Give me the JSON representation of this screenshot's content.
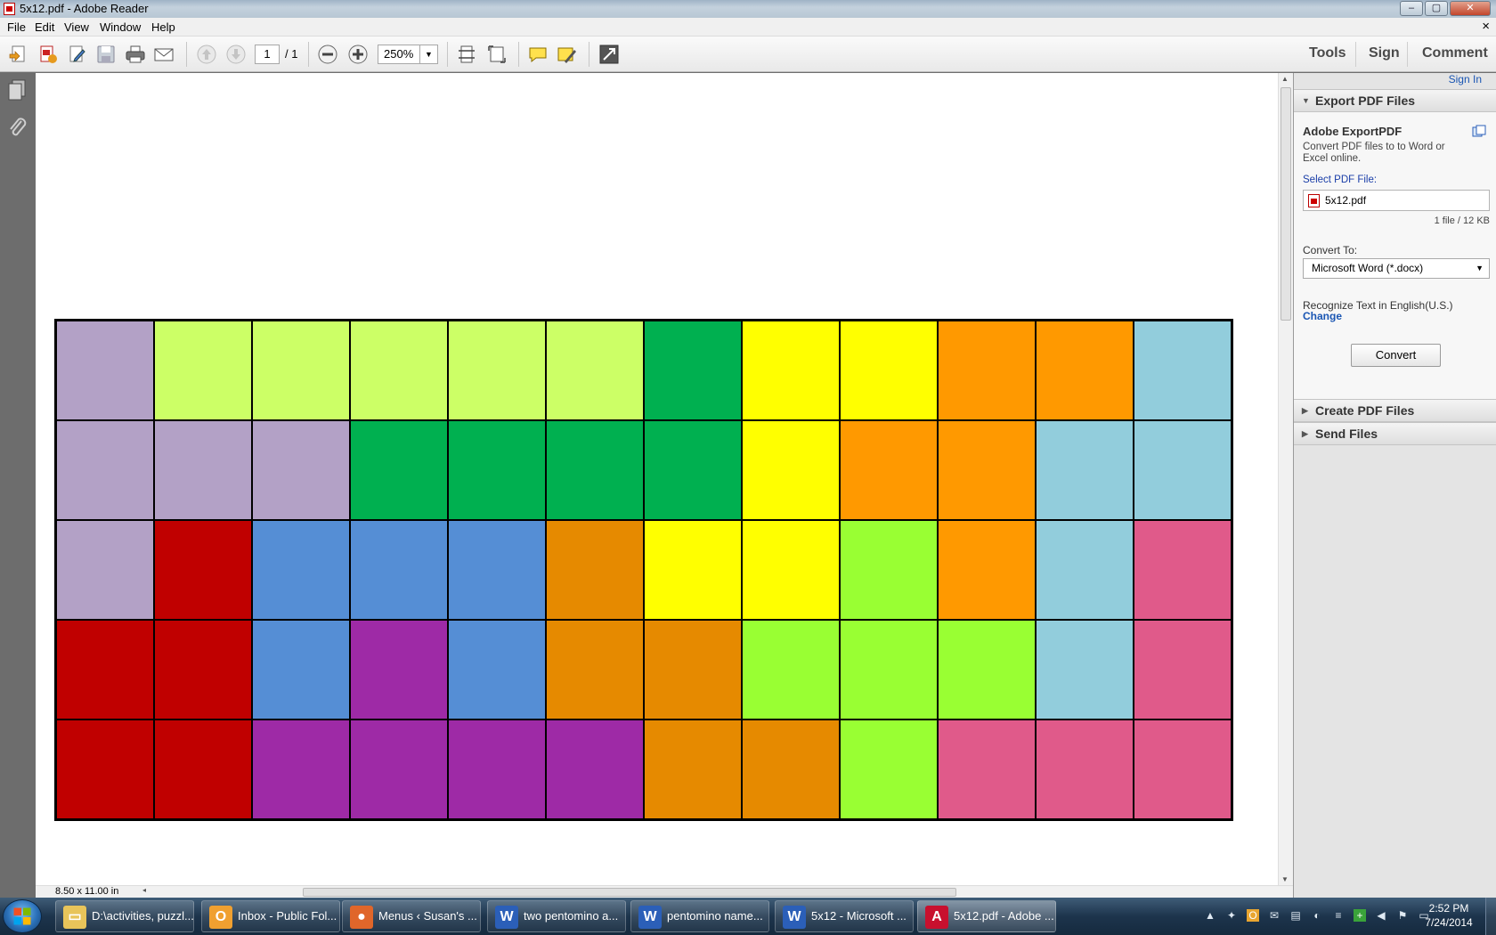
{
  "window": {
    "title": "5x12.pdf - Adobe Reader",
    "buttons": [
      "–",
      "▢",
      "✕"
    ]
  },
  "menu": {
    "items": [
      "File",
      "Edit",
      "View",
      "Window",
      "Help"
    ],
    "doc_close": "×"
  },
  "toolbar": {
    "page_current": "1",
    "page_total": "/ 1",
    "zoom": "250%",
    "right_links": [
      "Tools",
      "Sign",
      "Comment"
    ]
  },
  "document": {
    "page_size": "8.50 x 11.00 in",
    "grid_rows": [
      [
        "#b3a1c6",
        "#ccff66",
        "#ccff66",
        "#ccff66",
        "#ccff66",
        "#ccff66",
        "#00b050",
        "#ffff00",
        "#ffff00",
        "#ff9900",
        "#ff9900",
        "#92cddc"
      ],
      [
        "#b3a1c6",
        "#b3a1c6",
        "#b3a1c6",
        "#00b050",
        "#00b050",
        "#00b050",
        "#00b050",
        "#ffff00",
        "#ff9900",
        "#ff9900",
        "#92cddc",
        "#92cddc"
      ],
      [
        "#b3a1c6",
        "#c00000",
        "#558ed5",
        "#558ed5",
        "#558ed5",
        "#e68a00",
        "#ffff00",
        "#ffff00",
        "#99ff33",
        "#ff9900",
        "#92cddc",
        "#e05a8a"
      ],
      [
        "#c00000",
        "#c00000",
        "#558ed5",
        "#9e2aa6",
        "#558ed5",
        "#e68a00",
        "#e68a00",
        "#99ff33",
        "#99ff33",
        "#99ff33",
        "#92cddc",
        "#e05a8a"
      ],
      [
        "#c00000",
        "#c00000",
        "#9e2aa6",
        "#9e2aa6",
        "#9e2aa6",
        "#9e2aa6",
        "#e68a00",
        "#e68a00",
        "#99ff33",
        "#e05a8a",
        "#e05a8a",
        "#e05a8a"
      ]
    ]
  },
  "right_pane": {
    "sign_in": "Sign In",
    "export_header": "Export PDF Files",
    "export_title": "Adobe ExportPDF",
    "export_desc": "Convert PDF files to to Word or Excel online.",
    "select_label": "Select PDF File:",
    "file_name": "5x12.pdf",
    "file_info": "1 file / 12 KB",
    "convert_to_label": "Convert To:",
    "convert_to_value": "Microsoft Word (*.docx)",
    "recognize": "Recognize Text in English(U.S.)",
    "change": "Change",
    "convert_button": "Convert",
    "create_header": "Create PDF Files",
    "send_header": "Send Files"
  },
  "taskbar": {
    "tasks": [
      {
        "label": "D:\\activities, puzzl...",
        "icon": "folder-icon",
        "icon_bg": "#e8c45a",
        "glyph": "▭"
      },
      {
        "label": "Inbox - Public Fol...",
        "icon": "outlook-icon",
        "icon_bg": "#f0a030",
        "glyph": "O"
      },
      {
        "label": "Menus ‹ Susan's ...",
        "icon": "firefox-icon",
        "icon_bg": "#e0662a",
        "glyph": "●"
      },
      {
        "label": "two pentomino a...",
        "icon": "word-icon",
        "icon_bg": "#2b5fb8",
        "glyph": "W"
      },
      {
        "label": "pentomino name...",
        "icon": "word-icon",
        "icon_bg": "#2b5fb8",
        "glyph": "W"
      },
      {
        "label": "5x12 - Microsoft ...",
        "icon": "word-icon",
        "icon_bg": "#2b5fb8",
        "glyph": "W"
      },
      {
        "label": "5x12.pdf - Adobe ...",
        "icon": "adobe-reader-icon",
        "icon_bg": "#c8102e",
        "glyph": "A"
      }
    ],
    "time": "2:52 PM",
    "date": "7/24/2014"
  }
}
